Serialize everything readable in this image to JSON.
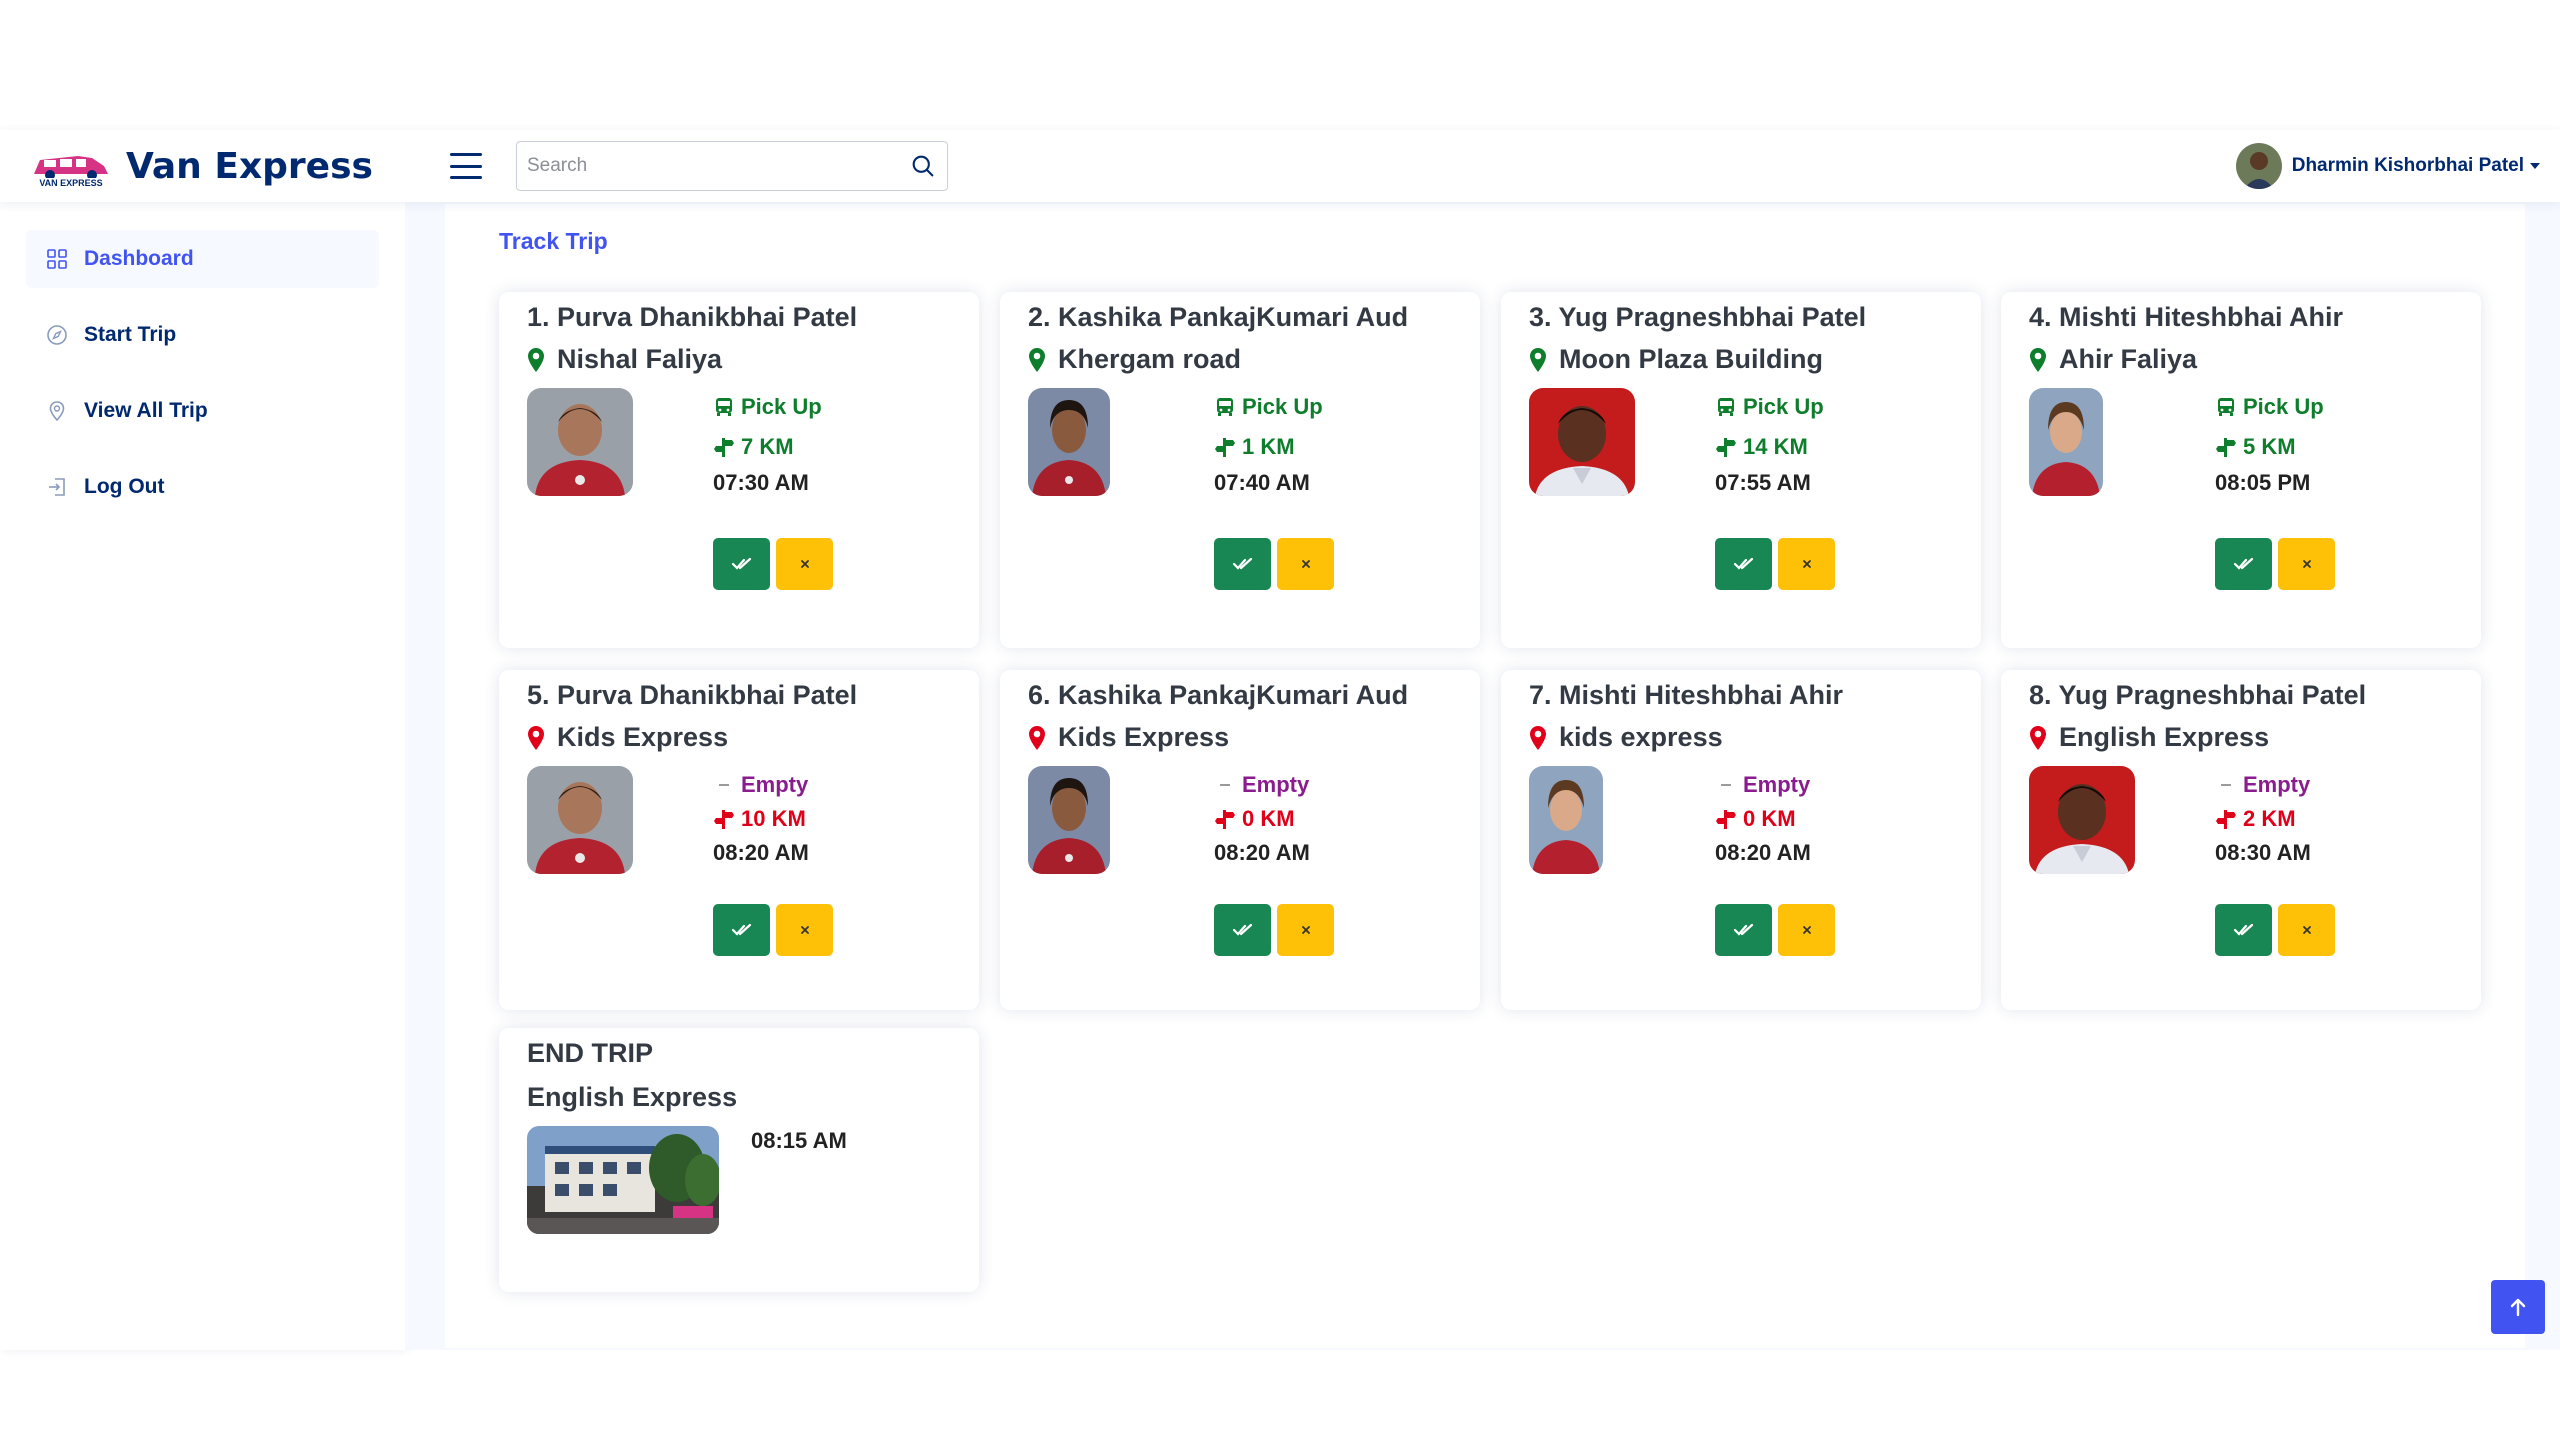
{
  "app": {
    "name": "Van Express",
    "logo_caption": "VAN EXPRESS"
  },
  "header": {
    "search_placeholder": "Search",
    "user_name": "Dharmin Kishorbhai Patel"
  },
  "sidebar": {
    "items": [
      {
        "label": "Dashboard",
        "icon": "grid-icon",
        "active": true
      },
      {
        "label": "Start Trip",
        "icon": "compass-icon",
        "active": false
      },
      {
        "label": "View All Trip",
        "icon": "map-pin-icon",
        "active": false
      },
      {
        "label": "Log Out",
        "icon": "logout-icon",
        "active": false
      }
    ]
  },
  "page": {
    "breadcrumb": "Track Trip"
  },
  "trips": [
    {
      "title": "1. Purva Dhanikbhai Patel",
      "location": "Nishal Faliya",
      "status": "Pick Up",
      "distance": "7 KM",
      "time": "07:30 AM"
    },
    {
      "title": "2. Kashika PankajKumari Aud",
      "location": "Khergam road",
      "status": "Pick Up",
      "distance": "1 KM",
      "time": "07:40 AM"
    },
    {
      "title": "3. Yug Pragneshbhai Patel",
      "location": "Moon Plaza Building",
      "status": "Pick Up",
      "distance": "14 KM",
      "time": "07:55 AM"
    },
    {
      "title": "4. Mishti Hiteshbhai Ahir",
      "location": "Ahir Faliya",
      "status": "Pick Up",
      "distance": "5 KM",
      "time": "08:05 PM"
    },
    {
      "title": "5. Purva Dhanikbhai Patel",
      "location": "Kids Express",
      "status": "Empty",
      "distance": "10 KM",
      "time": "08:20 AM"
    },
    {
      "title": "6. Kashika PankajKumari Aud",
      "location": "Kids Express",
      "status": "Empty",
      "distance": "0 KM",
      "time": "08:20 AM"
    },
    {
      "title": "7. Mishti Hiteshbhai Ahir",
      "location": "kids express",
      "status": "Empty",
      "distance": "0 KM",
      "time": "08:20 AM"
    },
    {
      "title": "8. Yug Pragneshbhai Patel",
      "location": "English Express",
      "status": "Empty",
      "distance": "2 KM",
      "time": "08:30 AM"
    }
  ],
  "end_trip": {
    "title": "END TRIP",
    "location": "English Express",
    "time": "08:15 AM"
  },
  "colors": {
    "brand": "#012970",
    "accent": "#4154f1",
    "pickup_green": "#0e7d2c",
    "drop_red": "#e0001a",
    "empty_purple": "#8a1c8f",
    "confirm": "#198754",
    "cancel": "#ffc107"
  }
}
